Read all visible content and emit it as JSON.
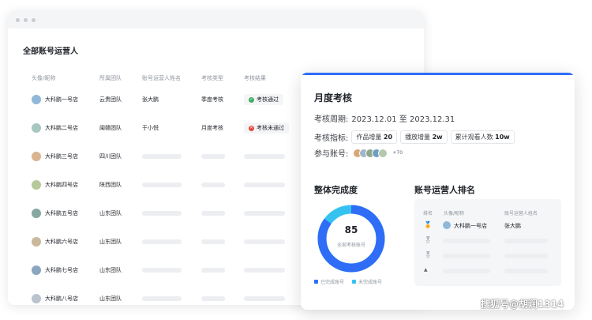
{
  "back_window": {
    "title": "全部账号运营人",
    "headers": [
      "头像/昵称",
      "所属团队",
      "账号运营人姓名",
      "考核类型",
      "考核结果"
    ],
    "rows": [
      {
        "name": "大科鹏一号店",
        "team": "云贵团队",
        "operator": "张大鹏",
        "type": "季度考核",
        "result": "考核通过",
        "status": "pass",
        "avatar_color": "#8fb8d8"
      },
      {
        "name": "大科鹏二号店",
        "team": "闽赣团队",
        "operator": "于小悦",
        "type": "月度考核",
        "result": "考核未通过",
        "status": "fail",
        "avatar_color": "#a7c7c0"
      },
      {
        "name": "大科鹏三号店",
        "team": "四川团队",
        "operator": "",
        "type": "",
        "result": "",
        "status": "none",
        "avatar_color": "#d9b48f"
      },
      {
        "name": "大科鹏四号店",
        "team": "陕西团队",
        "operator": "",
        "type": "",
        "result": "",
        "status": "none",
        "avatar_color": "#b5c99a"
      },
      {
        "name": "大科鹏五号店",
        "team": "山东团队",
        "operator": "",
        "type": "",
        "result": "",
        "status": "none",
        "avatar_color": "#86a8a0"
      },
      {
        "name": "大科鹏六号店",
        "team": "山东团队",
        "operator": "",
        "type": "",
        "result": "",
        "status": "none",
        "avatar_color": "#c9b89a"
      },
      {
        "name": "大科鹏七号店",
        "team": "山东团队",
        "operator": "",
        "type": "",
        "result": "",
        "status": "none",
        "avatar_color": "#8aa6c1"
      },
      {
        "name": "大科鹏八号店",
        "team": "山东团队",
        "operator": "",
        "type": "",
        "result": "",
        "status": "none",
        "avatar_color": "#b9c4cf"
      }
    ],
    "status_colors": {
      "pass": "#3fae62",
      "fail": "#e5483b"
    }
  },
  "card": {
    "title": "月度考核",
    "period_label": "考核周期:",
    "period_value": "2023.12.01 至 2023.12.31",
    "metrics_label": "考核指标:",
    "metrics": [
      {
        "name": "作品增量",
        "value": "20"
      },
      {
        "name": "播放增量",
        "value": "2w"
      },
      {
        "name": "累计观看人数",
        "value": "10w"
      }
    ],
    "accounts_label": "参与账号:",
    "accounts_more": "+70",
    "account_avatar_colors": [
      "#d9a877",
      "#9fb7c9",
      "#8fa88a",
      "#6f9fc0",
      "#b6c7b0"
    ],
    "completion": {
      "title": "整体完成度",
      "value": "85",
      "subtitle": "全部考核账号",
      "done_fraction": 0.85,
      "legend_done": "已完成账号",
      "legend_undone": "未完成账号",
      "color_done": "#2f6df6",
      "color_undone": "#36c2f0"
    },
    "ranking": {
      "title": "账号运营人排名",
      "headers": [
        "排名",
        "头像/昵称",
        "账号运营人姓名"
      ],
      "top": {
        "name": "大科鹏一号店",
        "operator": "张大鹏"
      },
      "medals": [
        "gold",
        "silver",
        "silver",
        "none"
      ]
    }
  },
  "watermark": "搜狐号@胡润1314"
}
